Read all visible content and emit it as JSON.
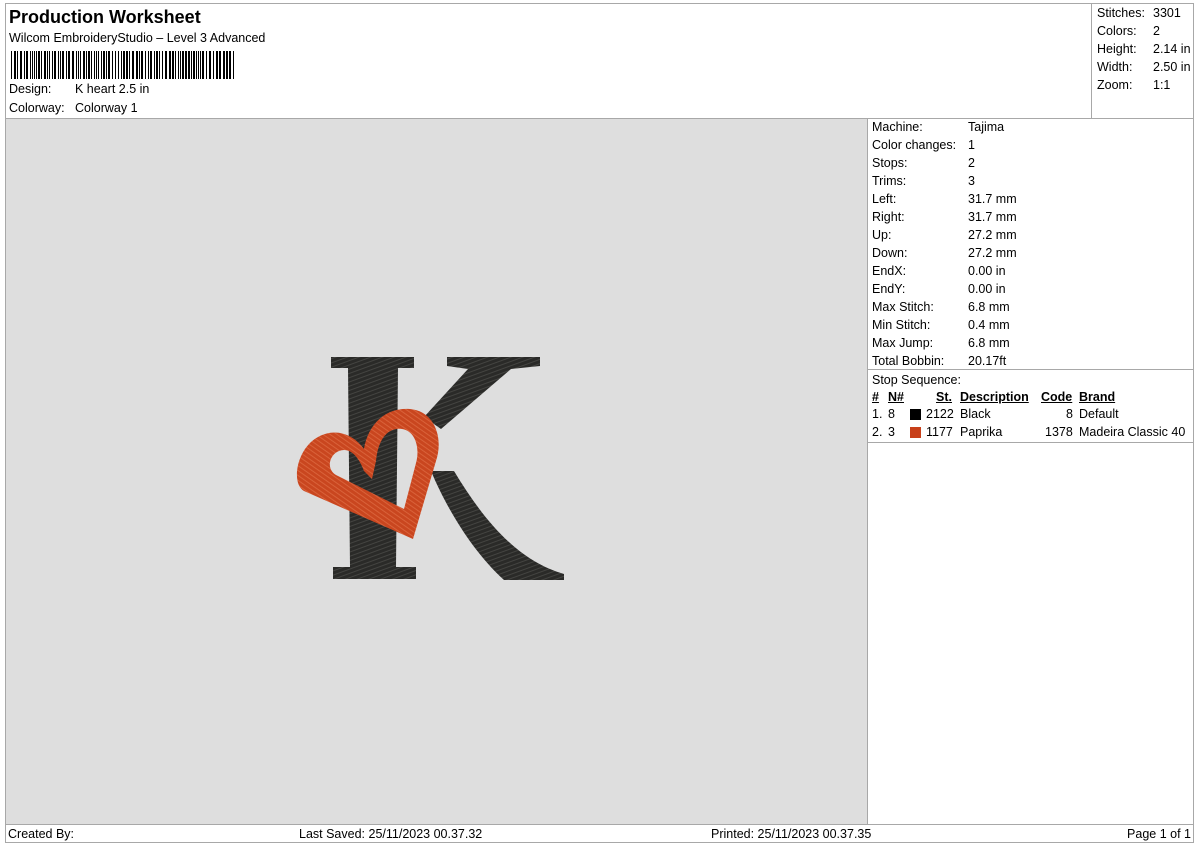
{
  "header": {
    "title": "Production Worksheet",
    "subtitle": "Wilcom EmbroideryStudio – Level 3 Advanced",
    "design_label": "Design:",
    "design_value": "K heart 2.5 in",
    "colorway_label": "Colorway:",
    "colorway_value": "Colorway 1"
  },
  "summary": {
    "stitches_label": "Stitches:",
    "stitches_value": "3301",
    "colors_label": "Colors:",
    "colors_value": "2",
    "height_label": "Height:",
    "height_value": "2.14 in",
    "width_label": "Width:",
    "width_value": "2.50 in",
    "zoom_label": "Zoom:",
    "zoom_value": "1:1"
  },
  "machine": {
    "rows": [
      {
        "label": "Machine:",
        "value": "Tajima"
      },
      {
        "label": "Color changes:",
        "value": "1"
      },
      {
        "label": "Stops:",
        "value": "2"
      },
      {
        "label": "Trims:",
        "value": "3"
      },
      {
        "label": "Left:",
        "value": "31.7 mm"
      },
      {
        "label": "Right:",
        "value": "31.7 mm"
      },
      {
        "label": "Up:",
        "value": "27.2 mm"
      },
      {
        "label": "Down:",
        "value": "27.2 mm"
      },
      {
        "label": "EndX:",
        "value": "0.00 in"
      },
      {
        "label": "EndY:",
        "value": "0.00 in"
      },
      {
        "label": "Max Stitch:",
        "value": "6.8 mm"
      },
      {
        "label": "Min Stitch:",
        "value": "0.4 mm"
      },
      {
        "label": "Max Jump:",
        "value": "6.8 mm"
      },
      {
        "label": "Total Bobbin:",
        "value": "20.17ft"
      }
    ]
  },
  "stops": {
    "caption": "Stop Sequence:",
    "headers": {
      "num": "#",
      "n": "N#",
      "st": "St.",
      "description": "Description",
      "code": "Code",
      "brand": "Brand"
    },
    "rows": [
      {
        "num": "1.",
        "n": "8",
        "color": "#000000",
        "st": "2122",
        "description": "Black",
        "code": "8",
        "brand": "Default"
      },
      {
        "num": "2.",
        "n": "3",
        "color": "#c8401a",
        "st": "1177",
        "description": "Paprika",
        "code": "1378",
        "brand": "Madeira Classic 40"
      }
    ]
  },
  "footer": {
    "created_by": "Created By:",
    "last_saved": "Last Saved: 25/11/2023 00.37.32",
    "printed": "Printed: 25/11/2023 00.37.35",
    "page": "Page 1 of 1"
  },
  "design_colors": {
    "black_thread": "#2a2a28",
    "paprika_thread": "#c9461f",
    "canvas_background": "#dedede"
  }
}
